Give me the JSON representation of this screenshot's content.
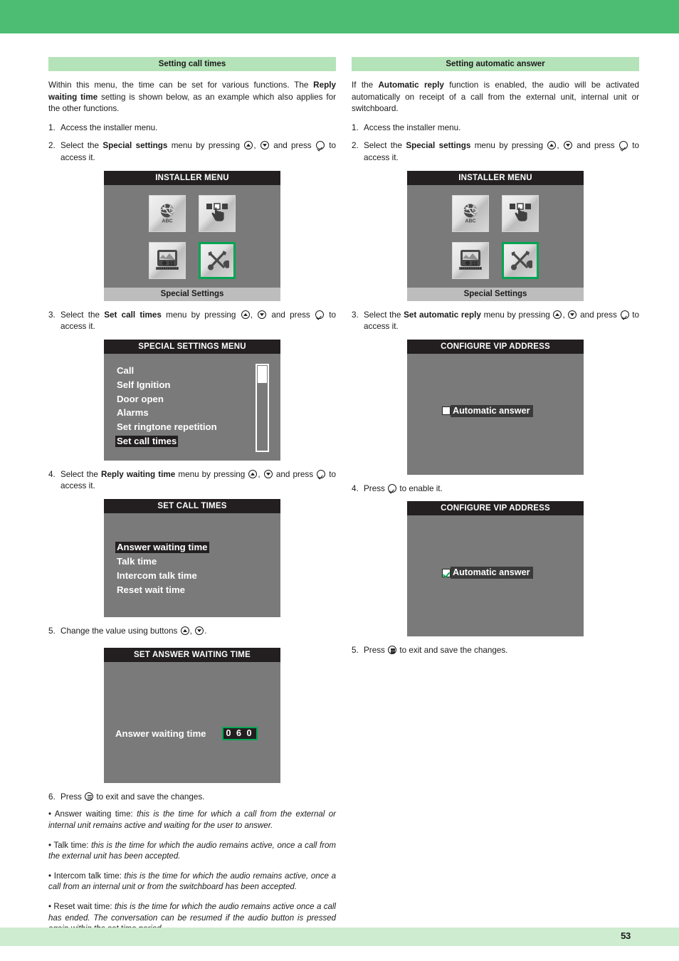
{
  "page": {
    "number": "53",
    "top_band_color": "#4ebd74",
    "bottom_band_color": "#cdecd0",
    "banner_color": "#b5e3b9",
    "accent_green": "#00a651"
  },
  "left": {
    "banner": "Setting call times",
    "intro_1": "Within this menu, the time can be set for various functions. The ",
    "intro_bold_1": "Reply waiting time",
    "intro_2": " setting is shown below, as an example which also applies for the other functions.",
    "step1_num": "1.",
    "step1_text": "Access the installer menu.",
    "step2_num": "2.",
    "step2_a": "Select the ",
    "step2_bold": "Special settings",
    "step2_b": " menu by pressing ",
    "step2_c": ", ",
    "step2_d": " and press ",
    "step2_e": " to access it.",
    "installer_screen": {
      "title": "INSTALLER MENU",
      "footer": "Special Settings",
      "icons": [
        {
          "name": "language-globe-icon",
          "label": "ABC",
          "selected": false
        },
        {
          "name": "hand-touch-buttons-icon",
          "label": "",
          "selected": false
        },
        {
          "name": "indoor-monitor-icon",
          "label": "",
          "selected": false
        },
        {
          "name": "tools-wrench-screwdriver-icon",
          "label": "",
          "selected": true
        }
      ]
    },
    "step3_num": "3.",
    "step3_a": "Select the ",
    "step3_bold": "Set call times",
    "step3_b": " menu by pressing ",
    "step3_c": ", ",
    "step3_d": " and press ",
    "step3_e": " to access it.",
    "special_settings_screen": {
      "title": "SPECIAL SETTINGS MENU",
      "items": [
        {
          "label": "Call",
          "highlighted": false
        },
        {
          "label": "Self Ignition",
          "highlighted": false
        },
        {
          "label": "Door open",
          "highlighted": false
        },
        {
          "label": "Alarms",
          "highlighted": false
        },
        {
          "label": "Set ringtone repetition",
          "highlighted": false
        },
        {
          "label": "Set call times",
          "highlighted": true
        }
      ],
      "scrollbar_position": "top"
    },
    "step4_num": "4.",
    "step4_a": "Select the ",
    "step4_bold": "Reply waiting time",
    "step4_b": " menu by pressing ",
    "step4_c": ", ",
    "step4_d": " and press ",
    "step4_e": " to access it.",
    "set_call_times_screen": {
      "title": "SET CALL TIMES",
      "items": [
        {
          "label": "Answer waiting time",
          "highlighted": true
        },
        {
          "label": "Talk time",
          "highlighted": false
        },
        {
          "label": "Intercom talk time",
          "highlighted": false
        },
        {
          "label": "Reset wait time",
          "highlighted": false
        }
      ]
    },
    "step5_num": "5.",
    "step5_a": "Change the value using buttons ",
    "step5_b": ", ",
    "step5_c": ".",
    "set_answer_waiting_screen": {
      "title": "SET ANSWER WAITING TIME",
      "label": "Answer waiting time",
      "value": "0 6 0"
    },
    "step6_num": "6.",
    "step6_a": "Press ",
    "step6_b": " to exit and save the changes.",
    "notes": [
      {
        "term": "• Answer waiting time: ",
        "desc": "this is the time for which a call from the external or internal unit remains active and waiting for the user to answer."
      },
      {
        "term": "• Talk time: ",
        "desc": "this is the time for which the audio remains active, once a call from the external unit has been accepted."
      },
      {
        "term": "• Intercom talk time: ",
        "desc": "this is the time for which the audio remains active, once a call from an internal unit or from the switchboard has been accepted."
      },
      {
        "term": "• Reset wait time: ",
        "desc": "this is the time for which the audio remains active once a call has ended. The conversation can be resumed if the audio button is pressed again within the set time period."
      }
    ]
  },
  "right": {
    "banner": "Setting automatic answer",
    "intro_1": "If the ",
    "intro_bold_1": "Automatic reply",
    "intro_2": " function is enabled, the audio will be activated automatically on receipt of a call from the external unit, internal unit or switchboard.",
    "step1_num": "1.",
    "step1_text": "Access the installer menu.",
    "step2_num": "2.",
    "step2_a": "Select the ",
    "step2_bold": "Special settings",
    "step2_b": " menu by pressing ",
    "step2_c": ", ",
    "step2_d": " and press ",
    "step2_e": " to access it.",
    "installer_screen": {
      "title": "INSTALLER MENU",
      "footer": "Special Settings",
      "icons": [
        {
          "name": "language-globe-icon",
          "label": "ABC",
          "selected": false
        },
        {
          "name": "hand-touch-buttons-icon",
          "label": "",
          "selected": false
        },
        {
          "name": "indoor-monitor-icon",
          "label": "",
          "selected": false
        },
        {
          "name": "tools-wrench-screwdriver-icon",
          "label": "",
          "selected": true
        }
      ]
    },
    "step3_num": "3.",
    "step3_a": "Select the ",
    "step3_bold": "Set automatic reply",
    "step3_b": " menu by pressing ",
    "step3_c": ", ",
    "step3_d": " and press ",
    "step3_e": " to access it.",
    "vip_screen_unchecked": {
      "title": "CONFIGURE VIP ADDRESS",
      "option_label": "Automatic answer",
      "checked": false
    },
    "step4_num": "4.",
    "step4_a": "Press ",
    "step4_b": " to enable it.",
    "vip_screen_checked": {
      "title": "CONFIGURE VIP ADDRESS",
      "option_label": "Automatic answer",
      "checked": true
    },
    "step5_num": "5.",
    "step5_a": "Press ",
    "step5_b": " to exit and save the changes."
  }
}
